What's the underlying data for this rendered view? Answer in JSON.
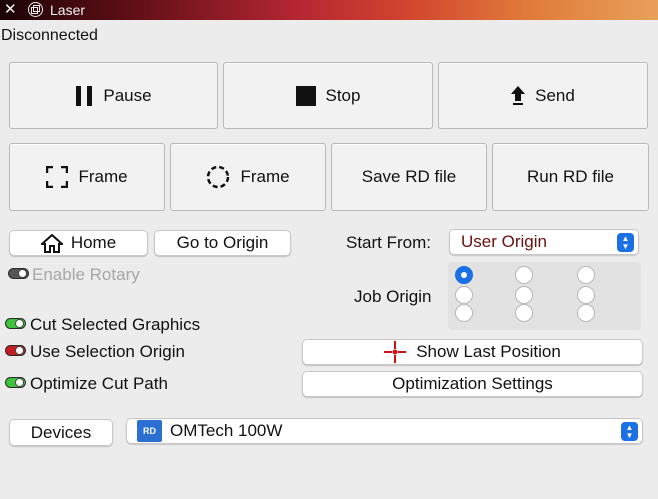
{
  "window": {
    "title": "Laser"
  },
  "status": "Disconnected",
  "row1": {
    "pause": "Pause",
    "stop": "Stop",
    "send": "Send"
  },
  "row2": {
    "frame_rect": "Frame",
    "frame_circle": "Frame",
    "save_rd": "Save RD file",
    "run_rd": "Run RD file"
  },
  "nav": {
    "home": "Home",
    "go_to_origin": "Go to Origin"
  },
  "start_from": {
    "label": "Start From:",
    "value": "User Origin",
    "value_color": "#6b1010"
  },
  "rotary": {
    "label": "Enable Rotary",
    "enabled": false
  },
  "job_origin": {
    "label": "Job Origin",
    "selected_index": 0
  },
  "options": {
    "cut_selected": {
      "label": "Cut Selected Graphics",
      "on": true
    },
    "use_selection_origin": {
      "label": "Use Selection Origin",
      "on": false
    },
    "optimize_cut_path": {
      "label": "Optimize Cut Path",
      "on": true
    }
  },
  "buttons": {
    "show_last_position": "Show Last Position",
    "optimization_settings": "Optimization Settings"
  },
  "devices": {
    "button": "Devices",
    "selected": "OMTech 100W",
    "logo_text": "RD"
  },
  "colors": {
    "accent": "#1b70e6",
    "toggle_on": "#3cc23c",
    "toggle_red": "#c41e22"
  }
}
